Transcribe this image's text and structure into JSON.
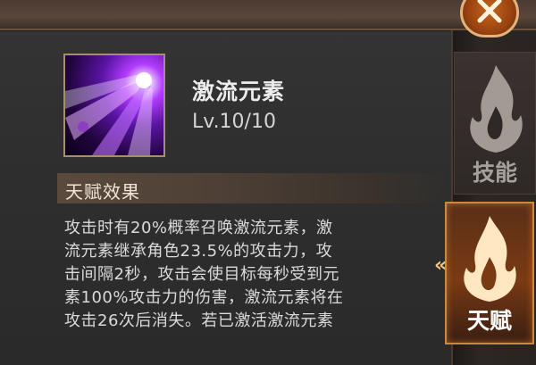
{
  "skill": {
    "name": "激流元素",
    "level": "Lv.10/10"
  },
  "talent_effect": {
    "title": "天赋效果",
    "lines": [
      "攻击时有20%概率召唤激流元素，激",
      "流元素继承角色23.5%的攻击力，攻",
      "击间隔2秒，攻击会使目标每秒受到元",
      "素100%攻击力的伤害，激流元素将在",
      "攻击26次后消失。若已激活激流元素"
    ]
  },
  "sidebar": {
    "tabs": [
      {
        "label": "技能",
        "icon": "flame-icon",
        "active": false
      },
      {
        "label": "天赋",
        "icon": "flame-icon",
        "active": true
      }
    ],
    "close_icon": "close-icon"
  },
  "colors": {
    "accent": "#c9893e",
    "panel_bg": "#2f2f2f",
    "text": "#dadada"
  }
}
